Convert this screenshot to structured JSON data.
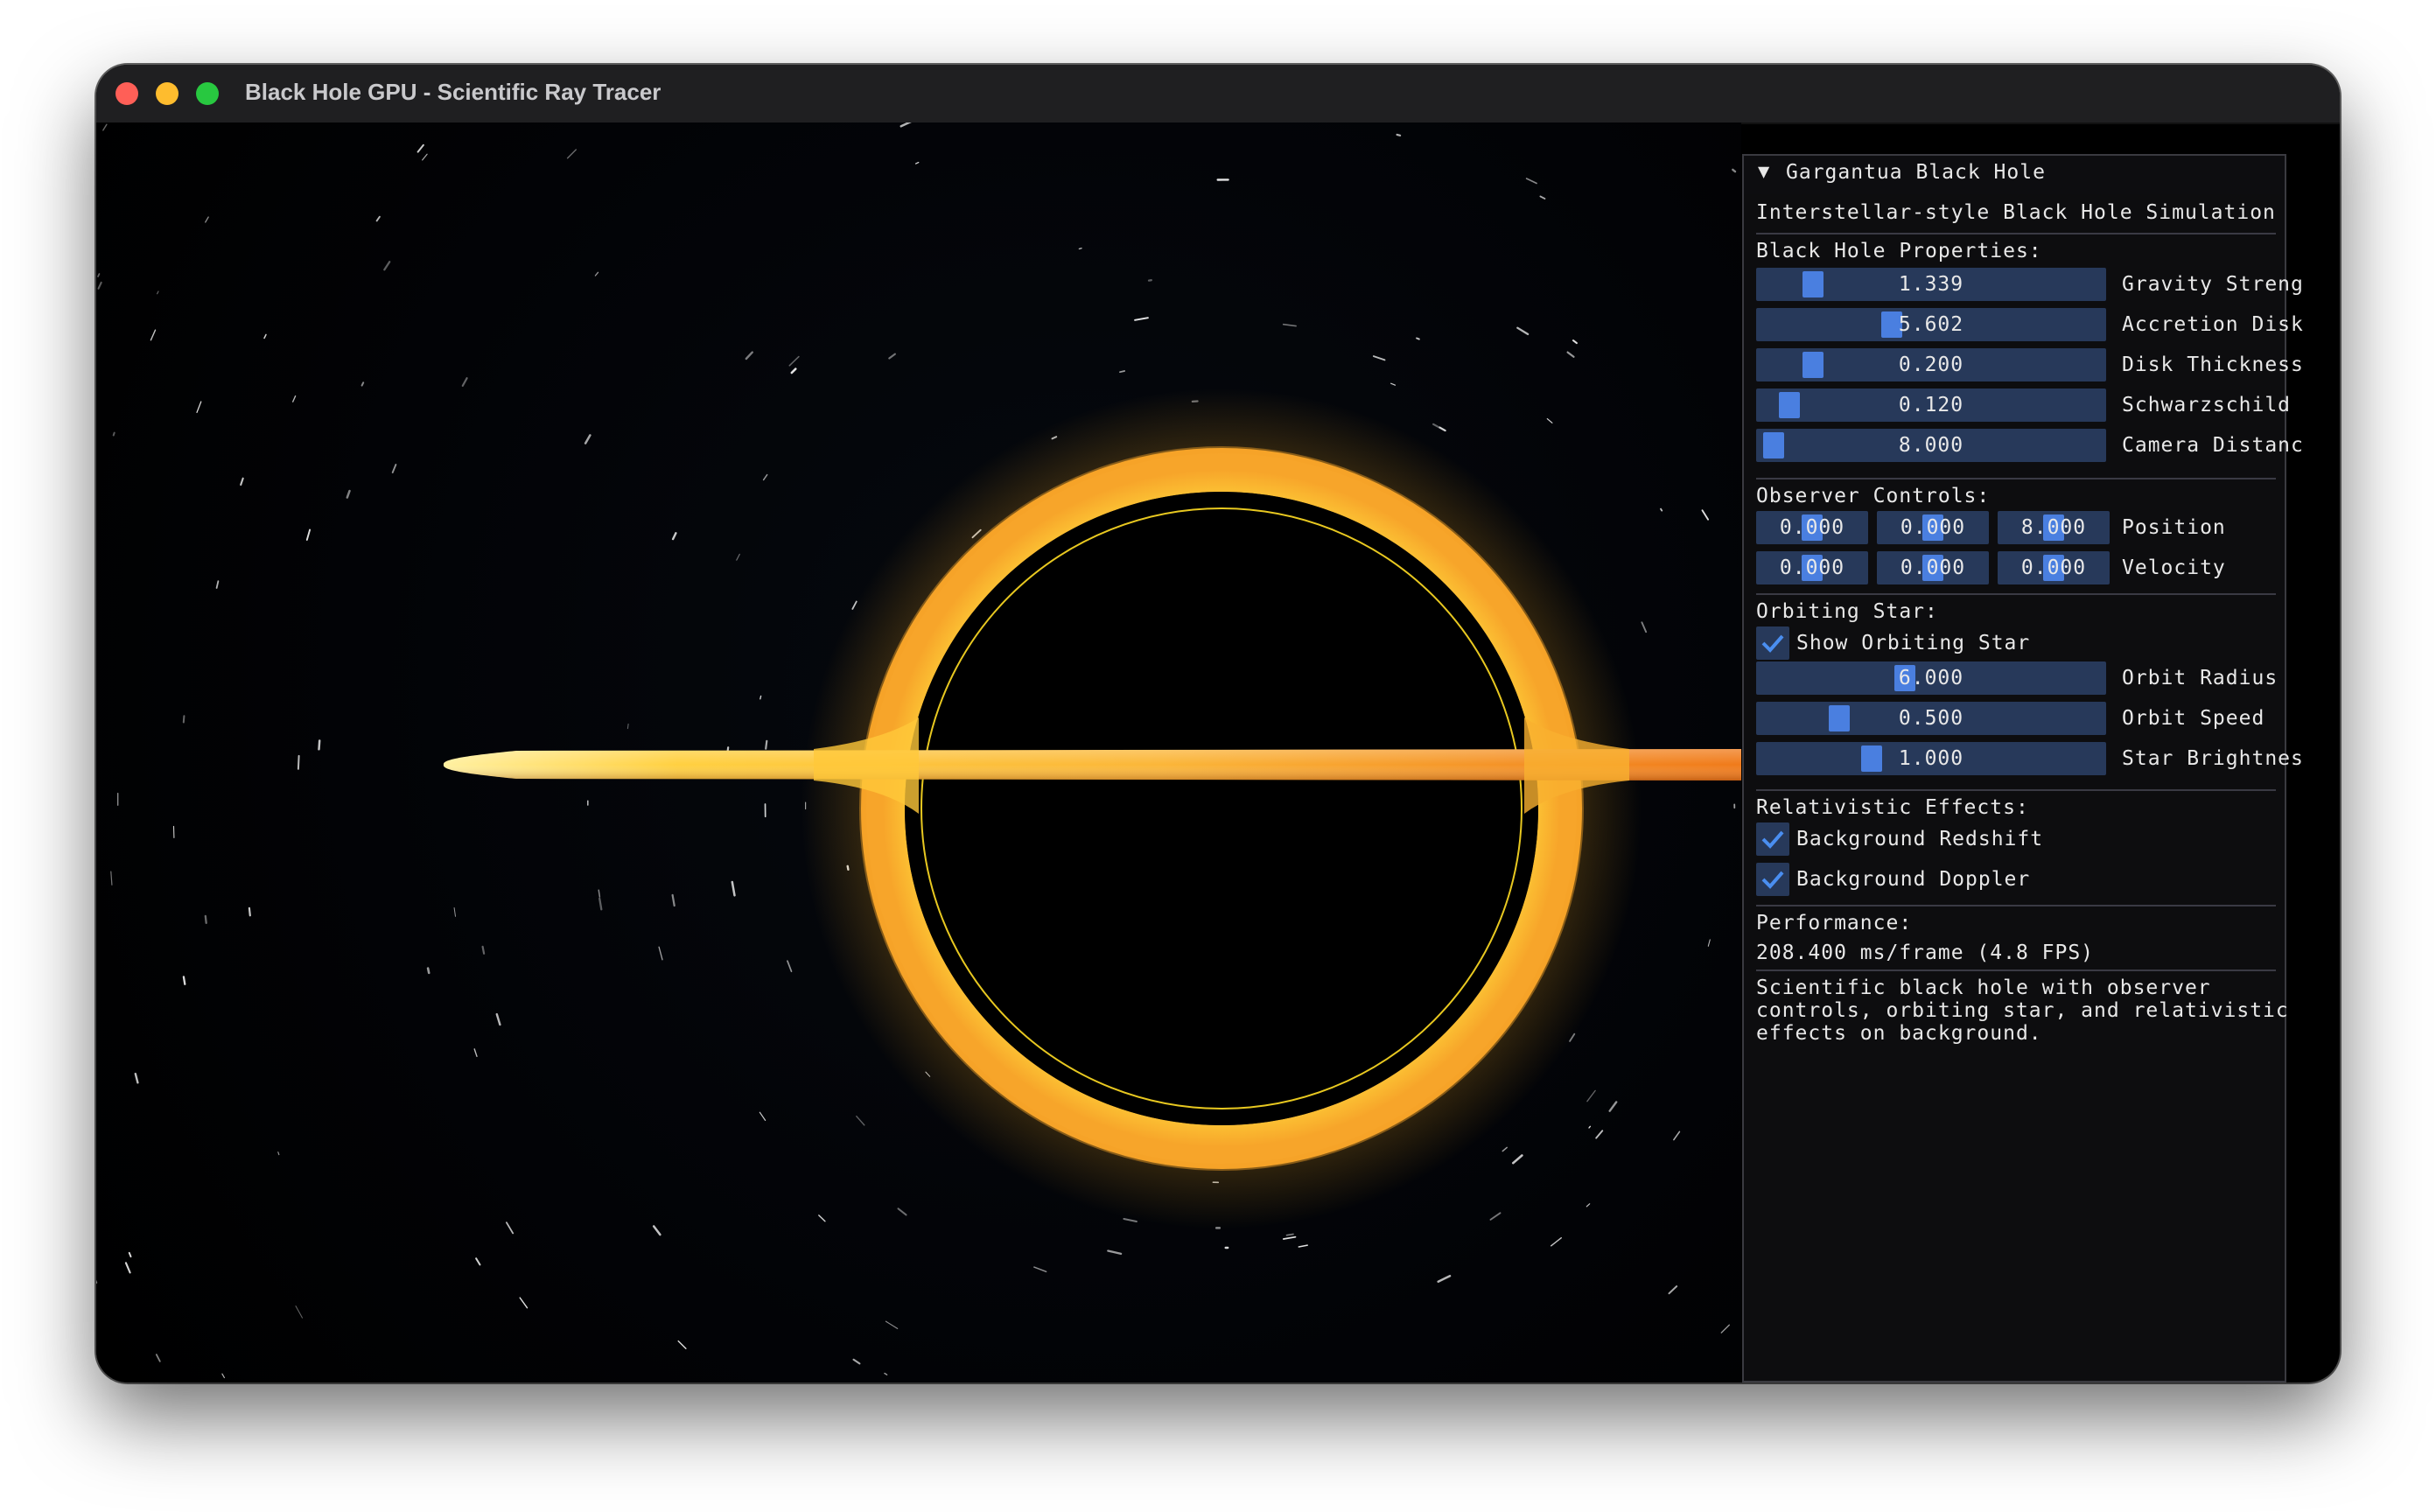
{
  "window": {
    "title": "Black Hole GPU - Scientific Ray Tracer"
  },
  "colors": {
    "accent": "#4a7fe0",
    "widget_bg": "#27395a",
    "disk_inner": "#ffe45a",
    "disk_outer": "#f58a1e"
  },
  "panel": {
    "header": "Gargantua Black Hole",
    "subtitle": "Interstellar-style Black Hole Simulation",
    "properties_heading": "Black Hole Properties:",
    "properties": [
      {
        "value": "1.339",
        "label": "Gravity Streng",
        "level": 0.14
      },
      {
        "value": "5.602",
        "label": "Accretion Disk",
        "level": 0.38
      },
      {
        "value": "0.200",
        "label": "Disk Thickness",
        "level": 0.14
      },
      {
        "value": "0.120",
        "label": "Schwarzschild",
        "level": 0.07
      },
      {
        "value": "8.000",
        "label": "Camera Distanc",
        "level": 0.02
      }
    ],
    "observer_heading": "Observer Controls:",
    "observer_rows": [
      {
        "label": "Position",
        "values": [
          "0.000",
          "0.000",
          "8.000"
        ]
      },
      {
        "label": "Velocity",
        "values": [
          "0.000",
          "0.000",
          "0.000"
        ]
      }
    ],
    "star_heading": "Orbiting Star:",
    "show_star_label": "Show Orbiting Star",
    "star_sliders": [
      {
        "value": "6.000",
        "label": "Orbit Radius",
        "level": 0.42
      },
      {
        "value": "0.500",
        "label": "Orbit Speed",
        "level": 0.22
      },
      {
        "value": "1.000",
        "label": "Star Brightnes",
        "level": 0.32
      }
    ],
    "effects_heading": "Relativistic Effects:",
    "effects": [
      {
        "label": "Background Redshift",
        "checked": true
      },
      {
        "label": "Background Doppler",
        "checked": true
      }
    ],
    "performance_heading": "Performance:",
    "performance_value": "208.400 ms/frame (4.8 FPS)",
    "description": [
      "Scientific black hole with observer",
      "controls, orbiting star, and relativistic",
      "effects on background."
    ]
  }
}
